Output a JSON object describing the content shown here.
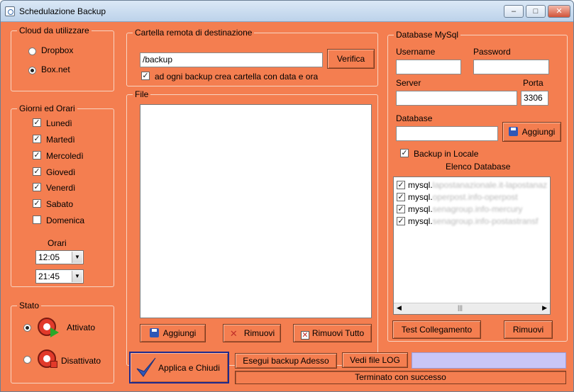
{
  "window": {
    "title": "Schedulazione Backup",
    "min_glyph": "–",
    "max_glyph": "□",
    "close_glyph": "✕"
  },
  "cloud": {
    "title": "Cloud da utilizzare",
    "options": [
      {
        "label": "Dropbox",
        "selected": false
      },
      {
        "label": "Box.net",
        "selected": true
      }
    ]
  },
  "schedule": {
    "title": "Giorni ed Orari",
    "days": [
      {
        "label": "Lunedì",
        "checked": true
      },
      {
        "label": "Martedì",
        "checked": true
      },
      {
        "label": "Mercoledì",
        "checked": true
      },
      {
        "label": "Giovedì",
        "checked": true
      },
      {
        "label": "Venerdì",
        "checked": true
      },
      {
        "label": "Sabato",
        "checked": true
      },
      {
        "label": "Domenica",
        "checked": false
      }
    ],
    "times_label": "Orari",
    "times": [
      "12:05",
      "21:45"
    ]
  },
  "state": {
    "title": "Stato",
    "options": [
      {
        "label": "Attivato",
        "selected": true
      },
      {
        "label": "Disattivato",
        "selected": false
      }
    ]
  },
  "remote": {
    "title": "Cartella remota di destinazione",
    "path_value": "/backup",
    "verify_label": "Verifica",
    "datefolder_label": "ad ogni backup crea cartella con data e ora",
    "datefolder_checked": true
  },
  "files": {
    "title": "File",
    "add_label": "Aggiungi",
    "remove_label": "Rimuovi",
    "remove_all_label": "Rimuovi Tutto"
  },
  "mysql": {
    "title": "Database MySql",
    "username_label": "Username",
    "password_label": "Password",
    "server_label": "Server",
    "port_label": "Porta",
    "port_value": "3306",
    "database_label": "Database",
    "add_label": "Aggiungi",
    "local_backup_label": "Backup in Locale",
    "local_backup_checked": true,
    "list_label": "Elenco Database",
    "databases": [
      {
        "prefix": "mysql.",
        "rest": "lapostanazionale.it-lapostanaz",
        "checked": true
      },
      {
        "prefix": "mysql.",
        "rest": "operpost.info-operpost",
        "checked": true
      },
      {
        "prefix": "mysql.",
        "rest": "senagroup.info-mercury",
        "checked": true
      },
      {
        "prefix": "mysql.",
        "rest": "senagroup.info-postastransf",
        "checked": true
      }
    ],
    "test_label": "Test Collegamento",
    "remove_label": "Rimuovi"
  },
  "bottom": {
    "apply_label": "Applica e Chiudi",
    "run_now_label": "Esegui backup Adesso",
    "log_label": "Vedi file LOG",
    "status_text": "Terminato con successo",
    "progress": 1.0
  },
  "colors": {
    "background": "#f47e50",
    "progress": "#c9c6f7",
    "apply_border": "#1f2a8c"
  }
}
